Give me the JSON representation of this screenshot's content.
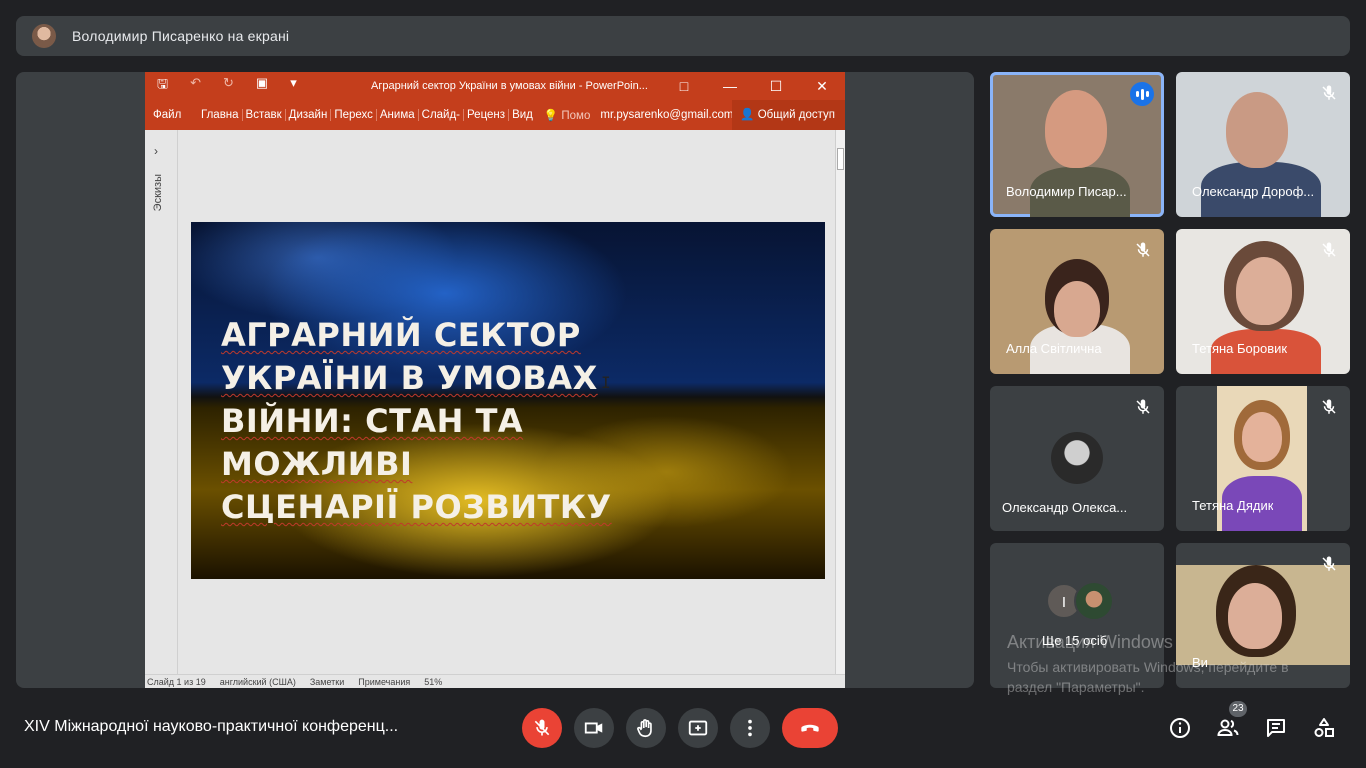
{
  "banner": {
    "text": "Володимир Писаренко на екрані"
  },
  "powerpoint": {
    "doc_title": "Аграрний сектор України в умовах війни - PowerPoin...",
    "ribbon": {
      "file": "Файл",
      "tabs": [
        "Главна",
        "Вставк",
        "Дизайн",
        "Перехс",
        "Анима",
        "Слайд-",
        "Реценз",
        "Вид"
      ],
      "help": "Помо",
      "email": "mr.pysarenko@gmail.com",
      "share": "Общий доступ"
    },
    "thumbnails_label": "Эскизы",
    "slide_heading_lines": [
      "АГРАРНИЙ СЕКТОР",
      "УКРАЇНИ В УМОВАХ",
      "ВІЙНИ: СТАН ТА МОЖЛИВІ",
      "СЦЕНАРІЇ РОЗВИТКУ"
    ],
    "status": {
      "slide": "Слайд 1 из 19",
      "language": "английский (США)",
      "notes": "Заметки",
      "comments": "Примечания",
      "zoom": "51%"
    }
  },
  "participants": [
    {
      "name": "Володимир Писар...",
      "speaking": true
    },
    {
      "name": "Олександр Дороф...",
      "muted": true
    },
    {
      "name": "Алла Світлична",
      "muted": true
    },
    {
      "name": "Тетяна Боровик",
      "muted": true
    },
    {
      "name": "Олександр Олекса...",
      "muted": true
    },
    {
      "name": "Тетяна Дядик",
      "muted": true
    },
    {
      "name": "Ще 15 осіб",
      "initial": "I"
    },
    {
      "name": "Ви",
      "muted": true
    }
  ],
  "meeting_title": "XIV Міжнародної науково-практичної конференц...",
  "people_count": "23",
  "watermark": {
    "line1": "Активация Windows",
    "line2": "Чтобы активировать Windows, перейдите в",
    "line3": "раздел \"Параметры\"."
  },
  "colors": {
    "accent": "#8ab4f8",
    "hangup": "#ea4335",
    "ppt": "#c43e1c"
  }
}
